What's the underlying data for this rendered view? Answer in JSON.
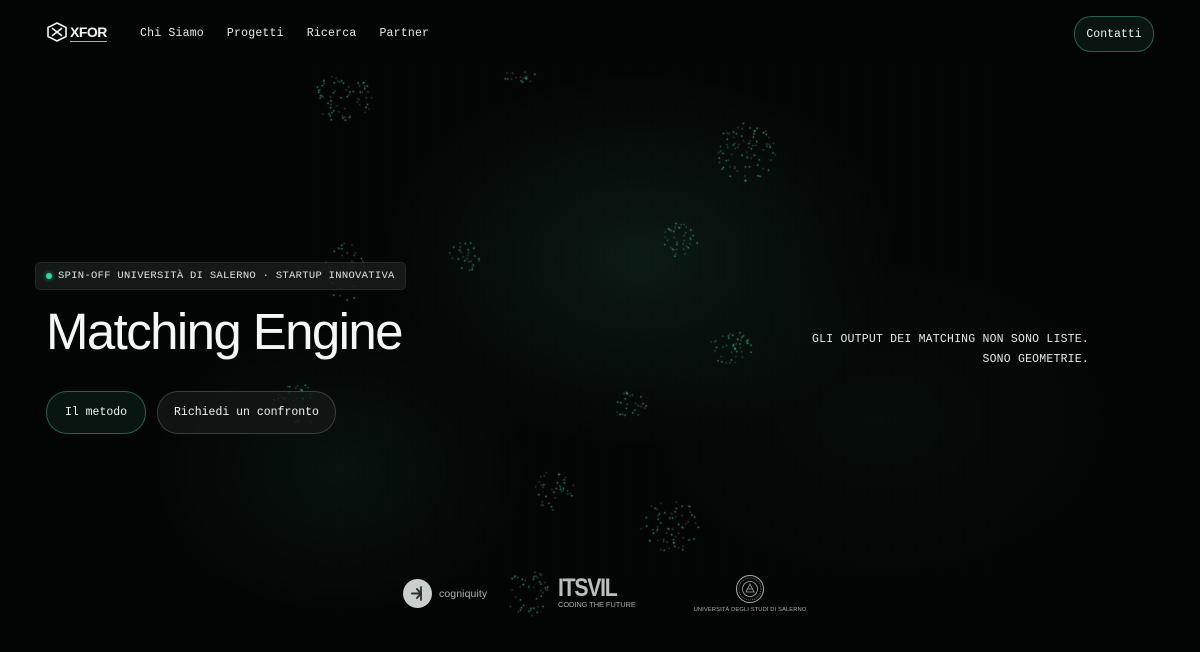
{
  "header": {
    "logo": {
      "text": "XFOR",
      "icon": "xfor-logo-icon"
    },
    "nav": [
      {
        "label": "Chi Siamo"
      },
      {
        "label": "Progetti"
      },
      {
        "label": "Ricerca"
      },
      {
        "label": "Partner"
      }
    ],
    "contact_label": "Contatti"
  },
  "hero": {
    "badge": "SPIN-OFF UNIVERSITÀ DI SALERNO · STARTUP INNOVATIVA",
    "title": "Matching Engine",
    "primary_button": "Il metodo",
    "secondary_button": "Richiedi un confronto",
    "tagline": [
      "GLI OUTPUT DEI MATCHING NON SONO LISTE.",
      "SONO GEOMETRIE."
    ]
  },
  "partners": {
    "cogniquity": {
      "name": "cogniquity",
      "icon": "cogniquity-logo-icon"
    },
    "itsvil": {
      "name": "ITSVIL",
      "subtitle": "CODING THE FUTURE"
    },
    "unisa": {
      "name": "UNIVERSITÀ DEGLI STUDI DI SALERNO",
      "icon": "university-seal-icon"
    }
  },
  "colors": {
    "background": "#030504",
    "accent": "#2fd6a0",
    "text": "#f4f7f6"
  }
}
